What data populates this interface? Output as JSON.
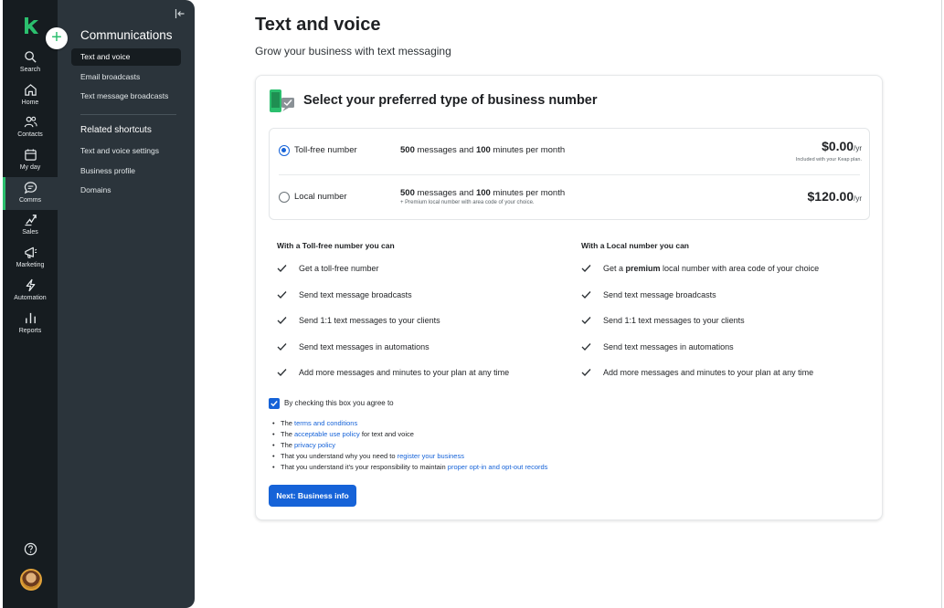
{
  "rail": {
    "items": [
      {
        "label": "Search",
        "icon": "search-icon"
      },
      {
        "label": "Home",
        "icon": "home-icon"
      },
      {
        "label": "Contacts",
        "icon": "contacts-icon"
      },
      {
        "label": "My day",
        "icon": "calendar-icon"
      },
      {
        "label": "Comms",
        "icon": "chat-icon",
        "active": true
      },
      {
        "label": "Sales",
        "icon": "sales-icon"
      },
      {
        "label": "Marketing",
        "icon": "megaphone-icon"
      },
      {
        "label": "Automation",
        "icon": "lightning-icon"
      },
      {
        "label": "Reports",
        "icon": "bar-chart-icon"
      }
    ],
    "help_icon": "help-icon",
    "avatar_icon": "user-avatar"
  },
  "subnav": {
    "title": "Communications",
    "links": [
      "Text and voice",
      "Email broadcasts",
      "Text message broadcasts"
    ],
    "active_link": "Text and voice",
    "section_title": "Related shortcuts",
    "shortcuts": [
      "Text and voice settings",
      "Business profile",
      "Domains"
    ],
    "add_button": "+"
  },
  "page": {
    "title": "Text and voice",
    "subtitle": "Grow your business with text messaging"
  },
  "card": {
    "heading": "Select your preferred type of business number",
    "options": [
      {
        "name": "Toll-free number",
        "messages": "500",
        "messages_text": " messages and ",
        "minutes": "100",
        "minutes_text": " minutes per month",
        "note": "",
        "price": "$0.00",
        "per": "/yr",
        "price_note": "Included with your Keap plan.",
        "selected": true
      },
      {
        "name": "Local number",
        "messages": "500",
        "messages_text": " messages and ",
        "minutes": "100",
        "minutes_text": " minutes per month",
        "note": "+ Premium local number with area code of your choice.",
        "price": "$120.00",
        "per": "/yr",
        "price_note": "",
        "selected": false
      }
    ],
    "tollfree_benefits": {
      "title": "With a Toll-free number you can",
      "items": [
        "Get a toll-free number",
        "Send text message broadcasts",
        "Send 1:1 text messages to your clients",
        "Send text messages in automations",
        "Add more messages and minutes to your plan at any time"
      ]
    },
    "local_benefits": {
      "title": "With a Local number you can",
      "first_prefix": "Get a ",
      "first_bold": "premium",
      "first_suffix": " local number with area code of your choice",
      "items": [
        "Send text message broadcasts",
        "Send 1:1 text messages to your clients",
        "Send text messages in automations",
        "Add more messages and minutes to your plan at any time"
      ]
    },
    "agree": {
      "label": "By checking this box you agree to",
      "checked": true
    },
    "terms": {
      "the": "The ",
      "terms_link": "terms and conditions",
      "aup_link": "acceptable use policy",
      "aup_suffix": " for text and voice",
      "privacy_link": "privacy policy",
      "register_prefix": "That you understand why you need to ",
      "register_link": "register your business",
      "optin_prefix": "That you understand it's your responsibility to maintain ",
      "optin_link": "proper opt-in and opt-out records"
    },
    "next_button": "Next: Business info"
  },
  "colors": {
    "brand_green": "#2bbf6e",
    "primary_blue": "#1663d8",
    "rail_bg": "#161c20",
    "subnav_bg": "#2b343b"
  }
}
